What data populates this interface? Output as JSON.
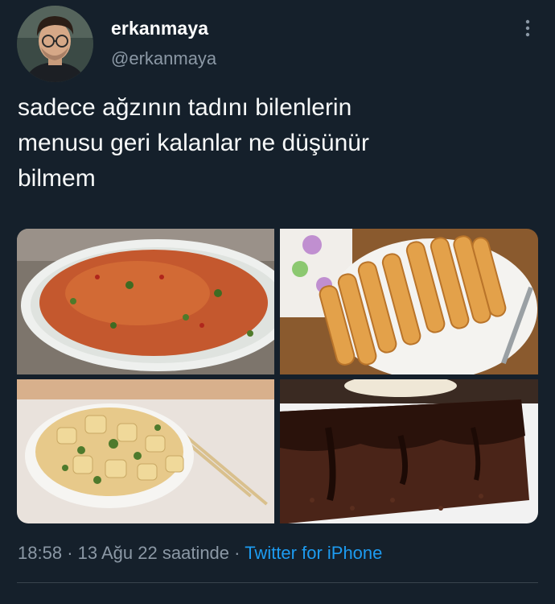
{
  "tweet": {
    "author": {
      "display_name": "erkanmaya",
      "handle": "@erkanmaya"
    },
    "text_lines": [
      "sadece ağzının tadını bilenlerin",
      "menusu geri kalanlar ne düşünür",
      "bilmem"
    ],
    "media": [
      {
        "subject": "kisir (bulgur salad) on a white oval plate"
      },
      {
        "subject": "fried cheese rolls (sigara böreği) on a white plate"
      },
      {
        "subject": "potato salad with herbs in a white bowl"
      },
      {
        "subject": "chocolate cake with chocolate sauce and coconut"
      }
    ],
    "meta": {
      "time": "18:58",
      "separator": "·",
      "date_text": "13 Ağu 22 saatinde",
      "separator2": "·",
      "source": "Twitter for iPhone"
    }
  },
  "colors": {
    "background": "#15202b",
    "text": "#f7f9f9",
    "secondary": "#8b98a5",
    "accent": "#1d9bf0",
    "divider": "#38444d"
  },
  "icons": {
    "more": "more-vertical-icon"
  }
}
